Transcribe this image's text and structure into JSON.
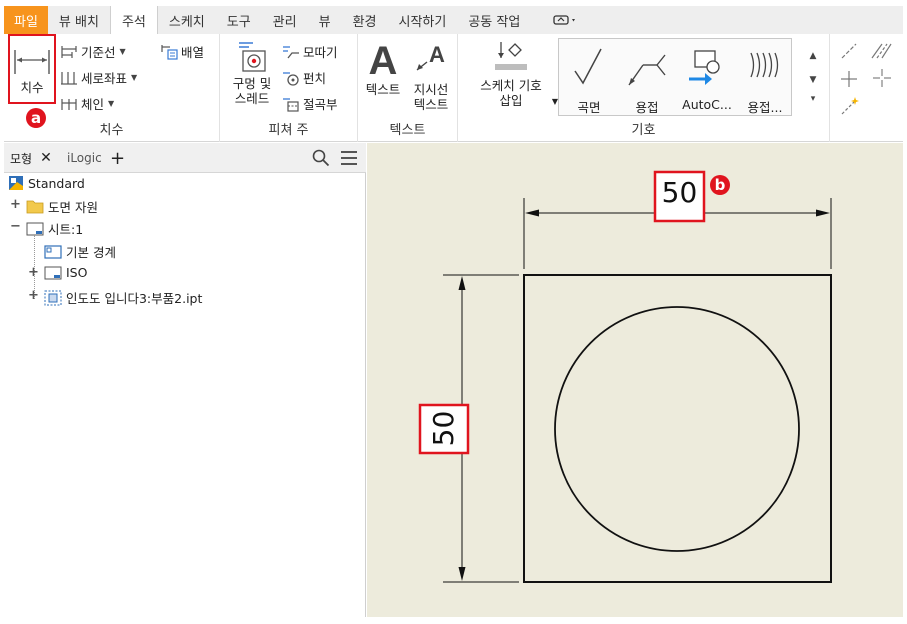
{
  "tabs": [
    {
      "label": "파일"
    },
    {
      "label": "뷰 배치"
    },
    {
      "label": "주석"
    },
    {
      "label": "스케치"
    },
    {
      "label": "도구"
    },
    {
      "label": "관리"
    },
    {
      "label": "뷰"
    },
    {
      "label": "환경"
    },
    {
      "label": "시작하기"
    },
    {
      "label": "공동 작업"
    }
  ],
  "ribbon": {
    "dimension_panel": {
      "title": "치수",
      "dimension_button": "치수",
      "baseline": "기준선",
      "ordinate": "세로좌표",
      "chain": "체인",
      "arrange": "배열"
    },
    "feature_panel": {
      "title": "피쳐 주",
      "hole_thread_line1": "구멍 및",
      "hole_thread_line2": "스레드",
      "chamfer": "모따기",
      "punch": "펀치",
      "bend": "절곡부"
    },
    "text_panel": {
      "title": "텍스트",
      "text": "텍스트",
      "leader_line1": "지시선",
      "leader_line2": "텍스트"
    },
    "symbol_panel": {
      "title": "기호",
      "insert_sketch_symbol_line1": "스케치 기호",
      "insert_sketch_symbol_line2": "삽입",
      "gallery": [
        {
          "label": "곡면"
        },
        {
          "label": "용접"
        },
        {
          "label": "AutoC..."
        },
        {
          "label": "용접..."
        }
      ]
    }
  },
  "markers": {
    "a": "ⓐ",
    "b": "ⓑ"
  },
  "browser": {
    "tabs": [
      {
        "label": "모형"
      },
      {
        "label": "iLogic"
      }
    ],
    "tree": [
      {
        "label": "Standard"
      },
      {
        "label": "도면 자원"
      },
      {
        "label": "시트:1"
      },
      {
        "label": "기본 경계"
      },
      {
        "label": "ISO"
      },
      {
        "label": "인도도 입니다3:부품2.ipt"
      }
    ]
  },
  "drawing": {
    "horizontal_dim": "50",
    "vertical_dim": "50"
  },
  "colors": {
    "file_tab": "#f7941d",
    "highlight": "#e0141e",
    "canvas_bg": "#edebdc"
  }
}
